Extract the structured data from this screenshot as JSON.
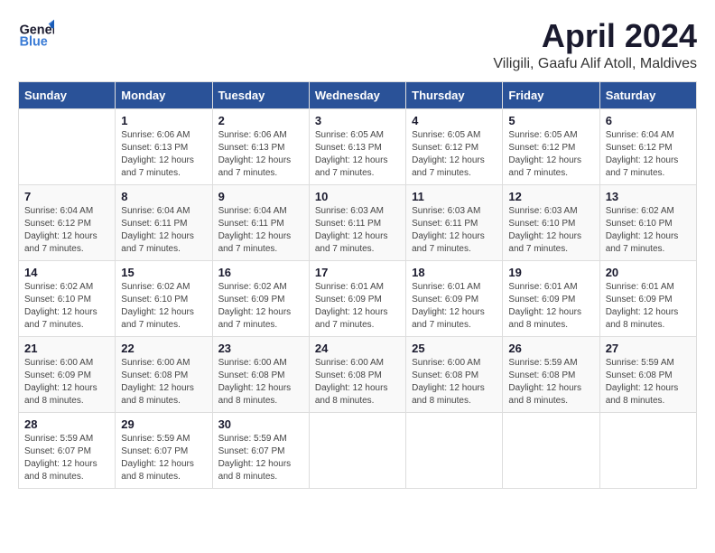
{
  "header": {
    "logo": {
      "line1": "General",
      "line2": "Blue"
    },
    "title": "April 2024",
    "location": "Viligili, Gaafu Alif Atoll, Maldives"
  },
  "calendar": {
    "headers": [
      "Sunday",
      "Monday",
      "Tuesday",
      "Wednesday",
      "Thursday",
      "Friday",
      "Saturday"
    ],
    "weeks": [
      [
        {
          "day": "",
          "info": ""
        },
        {
          "day": "1",
          "info": "Sunrise: 6:06 AM\nSunset: 6:13 PM\nDaylight: 12 hours\nand 7 minutes."
        },
        {
          "day": "2",
          "info": "Sunrise: 6:06 AM\nSunset: 6:13 PM\nDaylight: 12 hours\nand 7 minutes."
        },
        {
          "day": "3",
          "info": "Sunrise: 6:05 AM\nSunset: 6:13 PM\nDaylight: 12 hours\nand 7 minutes."
        },
        {
          "day": "4",
          "info": "Sunrise: 6:05 AM\nSunset: 6:12 PM\nDaylight: 12 hours\nand 7 minutes."
        },
        {
          "day": "5",
          "info": "Sunrise: 6:05 AM\nSunset: 6:12 PM\nDaylight: 12 hours\nand 7 minutes."
        },
        {
          "day": "6",
          "info": "Sunrise: 6:04 AM\nSunset: 6:12 PM\nDaylight: 12 hours\nand 7 minutes."
        }
      ],
      [
        {
          "day": "7",
          "info": "Sunrise: 6:04 AM\nSunset: 6:12 PM\nDaylight: 12 hours\nand 7 minutes."
        },
        {
          "day": "8",
          "info": "Sunrise: 6:04 AM\nSunset: 6:11 PM\nDaylight: 12 hours\nand 7 minutes."
        },
        {
          "day": "9",
          "info": "Sunrise: 6:04 AM\nSunset: 6:11 PM\nDaylight: 12 hours\nand 7 minutes."
        },
        {
          "day": "10",
          "info": "Sunrise: 6:03 AM\nSunset: 6:11 PM\nDaylight: 12 hours\nand 7 minutes."
        },
        {
          "day": "11",
          "info": "Sunrise: 6:03 AM\nSunset: 6:11 PM\nDaylight: 12 hours\nand 7 minutes."
        },
        {
          "day": "12",
          "info": "Sunrise: 6:03 AM\nSunset: 6:10 PM\nDaylight: 12 hours\nand 7 minutes."
        },
        {
          "day": "13",
          "info": "Sunrise: 6:02 AM\nSunset: 6:10 PM\nDaylight: 12 hours\nand 7 minutes."
        }
      ],
      [
        {
          "day": "14",
          "info": "Sunrise: 6:02 AM\nSunset: 6:10 PM\nDaylight: 12 hours\nand 7 minutes."
        },
        {
          "day": "15",
          "info": "Sunrise: 6:02 AM\nSunset: 6:10 PM\nDaylight: 12 hours\nand 7 minutes."
        },
        {
          "day": "16",
          "info": "Sunrise: 6:02 AM\nSunset: 6:09 PM\nDaylight: 12 hours\nand 7 minutes."
        },
        {
          "day": "17",
          "info": "Sunrise: 6:01 AM\nSunset: 6:09 PM\nDaylight: 12 hours\nand 7 minutes."
        },
        {
          "day": "18",
          "info": "Sunrise: 6:01 AM\nSunset: 6:09 PM\nDaylight: 12 hours\nand 7 minutes."
        },
        {
          "day": "19",
          "info": "Sunrise: 6:01 AM\nSunset: 6:09 PM\nDaylight: 12 hours\nand 8 minutes."
        },
        {
          "day": "20",
          "info": "Sunrise: 6:01 AM\nSunset: 6:09 PM\nDaylight: 12 hours\nand 8 minutes."
        }
      ],
      [
        {
          "day": "21",
          "info": "Sunrise: 6:00 AM\nSunset: 6:09 PM\nDaylight: 12 hours\nand 8 minutes."
        },
        {
          "day": "22",
          "info": "Sunrise: 6:00 AM\nSunset: 6:08 PM\nDaylight: 12 hours\nand 8 minutes."
        },
        {
          "day": "23",
          "info": "Sunrise: 6:00 AM\nSunset: 6:08 PM\nDaylight: 12 hours\nand 8 minutes."
        },
        {
          "day": "24",
          "info": "Sunrise: 6:00 AM\nSunset: 6:08 PM\nDaylight: 12 hours\nand 8 minutes."
        },
        {
          "day": "25",
          "info": "Sunrise: 6:00 AM\nSunset: 6:08 PM\nDaylight: 12 hours\nand 8 minutes."
        },
        {
          "day": "26",
          "info": "Sunrise: 5:59 AM\nSunset: 6:08 PM\nDaylight: 12 hours\nand 8 minutes."
        },
        {
          "day": "27",
          "info": "Sunrise: 5:59 AM\nSunset: 6:08 PM\nDaylight: 12 hours\nand 8 minutes."
        }
      ],
      [
        {
          "day": "28",
          "info": "Sunrise: 5:59 AM\nSunset: 6:07 PM\nDaylight: 12 hours\nand 8 minutes."
        },
        {
          "day": "29",
          "info": "Sunrise: 5:59 AM\nSunset: 6:07 PM\nDaylight: 12 hours\nand 8 minutes."
        },
        {
          "day": "30",
          "info": "Sunrise: 5:59 AM\nSunset: 6:07 PM\nDaylight: 12 hours\nand 8 minutes."
        },
        {
          "day": "",
          "info": ""
        },
        {
          "day": "",
          "info": ""
        },
        {
          "day": "",
          "info": ""
        },
        {
          "day": "",
          "info": ""
        }
      ]
    ]
  }
}
